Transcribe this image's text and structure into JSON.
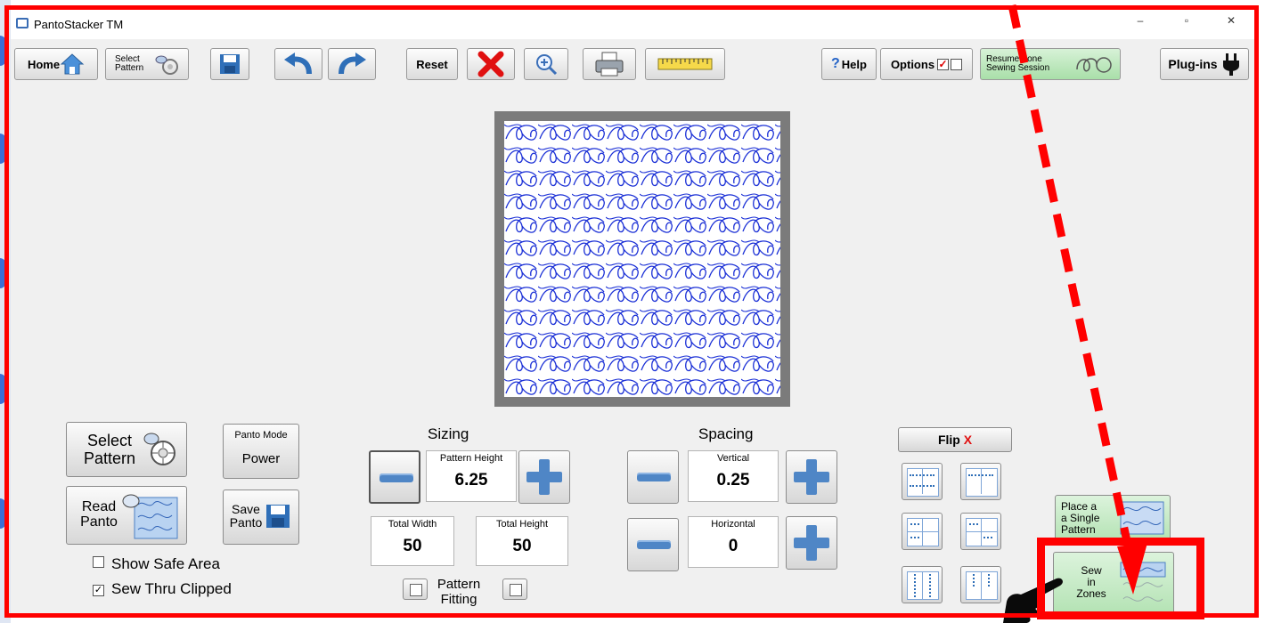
{
  "window": {
    "title": "PantoStacker TM",
    "controls": [
      "–",
      "▫",
      "✕"
    ]
  },
  "toolbar": {
    "home_label": "Home",
    "select_pattern_label_1": "Select",
    "select_pattern_label_2": "Pattern",
    "reset_label": "Reset",
    "help_label": "Help",
    "help_prefix": "?",
    "options_label": "Options",
    "resume_label_1": "Resume Zone",
    "resume_label_2": "Sewing Session",
    "plugins_label": "Plug-ins"
  },
  "left_panel": {
    "select_pattern_1": "Select",
    "select_pattern_2": "Pattern",
    "panto_mode_label": "Panto Mode",
    "panto_mode_value": "Power",
    "read_panto_1": "Read",
    "read_panto_2": "Panto",
    "save_panto_1": "Save",
    "save_panto_2": "Panto",
    "show_safe_area": {
      "label": "Show Safe Area",
      "checked": false
    },
    "sew_thru_clipped": {
      "label": "Sew Thru Clipped",
      "checked": true
    }
  },
  "sizing": {
    "title": "Sizing",
    "pattern_height_label": "Pattern Height",
    "pattern_height_value": "6.25",
    "total_width_label": "Total Width",
    "total_width_value": "50",
    "total_height_label": "Total Height",
    "total_height_value": "50",
    "pattern_fitting_1": "Pattern",
    "pattern_fitting_2": "Fitting"
  },
  "spacing": {
    "title": "Spacing",
    "vertical_label": "Vertical",
    "vertical_value": "0.25",
    "horizontal_label": "Horizontal",
    "horizontal_value": "0"
  },
  "right_panel": {
    "flip_label": "Flip",
    "flip_mark": "X",
    "place_single_1": "Place a",
    "place_single_2": "a Single",
    "place_single_3": "Pattern",
    "sew_zones_1": "Sew",
    "sew_zones_2": "in",
    "sew_zones_3": "Zones"
  },
  "colors": {
    "accent_red": "#ff0000",
    "pattern_blue": "#1a2fd6",
    "button_blue": "#4f86c6"
  },
  "icons": [
    "home-icon",
    "select-pattern-icon",
    "save-icon",
    "undo-icon",
    "redo-icon",
    "delete-icon",
    "zoom-icon",
    "print-icon",
    "ruler-icon",
    "plug-icon",
    "hand-pointer-icon"
  ]
}
